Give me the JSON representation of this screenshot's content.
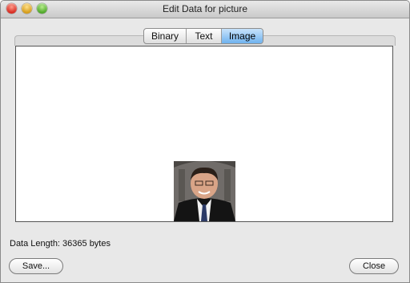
{
  "window": {
    "title": "Edit Data for picture"
  },
  "tabs": [
    {
      "label": "Binary",
      "selected": false
    },
    {
      "label": "Text",
      "selected": false
    },
    {
      "label": "Image",
      "selected": true
    }
  ],
  "status": {
    "data_length": "Data Length: 36365 bytes"
  },
  "buttons": {
    "save": "Save...",
    "close": "Close"
  },
  "colors": {
    "selected_tab": "#6fb2ef",
    "close_light": "#d6261c",
    "minimize_light": "#d49a14",
    "zoom_light": "#4aa524"
  }
}
